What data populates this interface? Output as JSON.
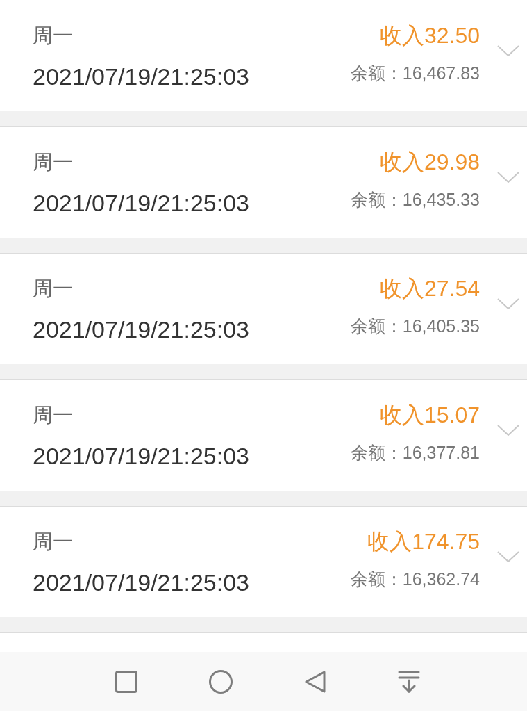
{
  "records": [
    {
      "weekday": "周一",
      "datetime": "2021/07/19/21:25:03",
      "amount": "收入32.50",
      "balance": "余额：16,467.83",
      "expanded": false
    },
    {
      "weekday": "周一",
      "datetime": "2021/07/19/21:25:03",
      "amount": "收入29.98",
      "balance": "余额：16,435.33",
      "expanded": false
    },
    {
      "weekday": "周一",
      "datetime": "2021/07/19/21:25:03",
      "amount": "收入27.54",
      "balance": "余额：16,405.35",
      "expanded": false
    },
    {
      "weekday": "周一",
      "datetime": "2021/07/19/21:25:03",
      "amount": "收入15.07",
      "balance": "余额：16,377.81",
      "expanded": false
    },
    {
      "weekday": "周一",
      "datetime": "2021/07/19/21:25:03",
      "amount": "收入174.75",
      "balance": "余额：16,362.74",
      "expanded": false
    }
  ]
}
